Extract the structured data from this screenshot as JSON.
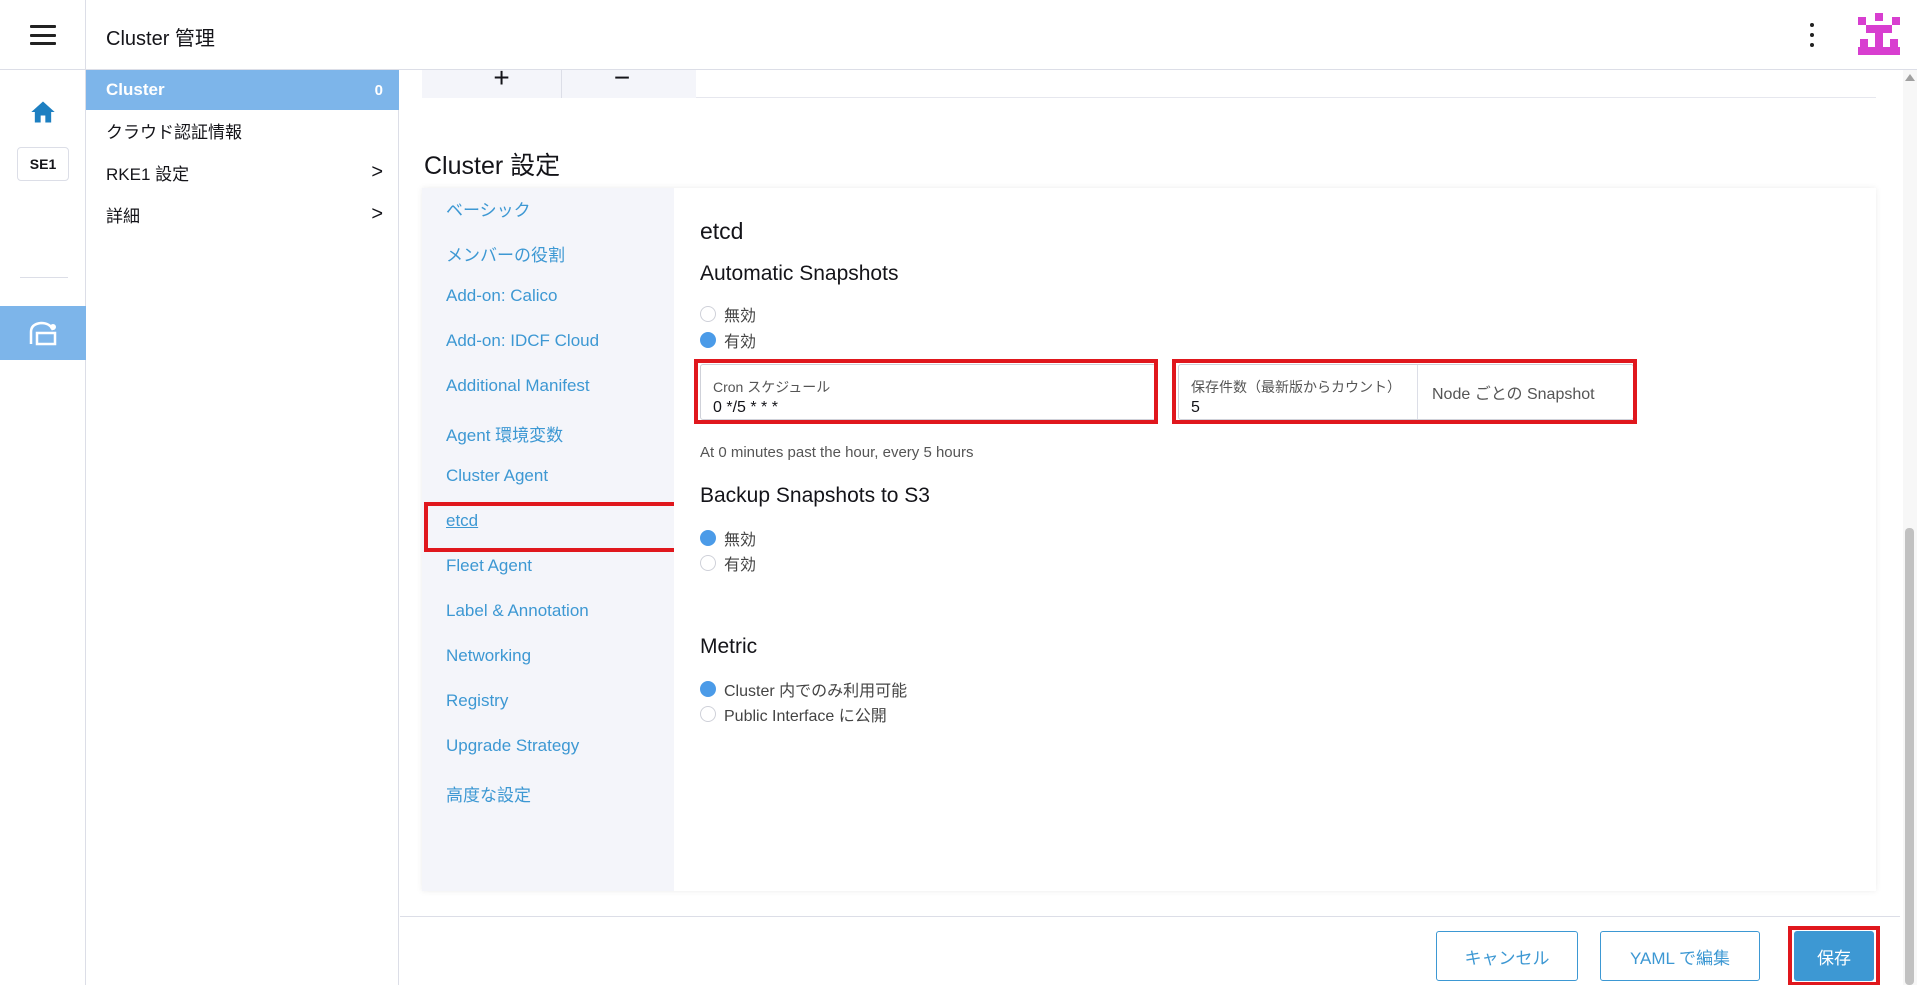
{
  "header": {
    "title": "Cluster 管理",
    "menu_icon": "hamburger-icon",
    "more_icon": "kebab-icon",
    "avatar_color": "#d83ed0"
  },
  "rail": {
    "home_icon": "home-icon",
    "cluster_badge": "SE1",
    "active_icon": "cluster-icon"
  },
  "subnav": {
    "items": [
      {
        "label": "Cluster",
        "count": "0",
        "active": true
      },
      {
        "label": "クラウド認証情報"
      },
      {
        "label": "RKE1 設定",
        "chevron": ">"
      },
      {
        "label": "詳細",
        "chevron": ">"
      }
    ]
  },
  "main": {
    "top_card": {
      "plus": "+",
      "minus": "−"
    },
    "section_title": "Cluster 設定",
    "settings_nav": [
      "ベーシック",
      "メンバーの役割",
      "Add-on: Calico",
      "Add-on: IDCF Cloud",
      "Additional Manifest",
      "Agent 環境変数",
      "Cluster Agent",
      "etcd",
      "Fleet Agent",
      "Label & Annotation",
      "Networking",
      "Registry",
      "Upgrade Strategy",
      "高度な設定"
    ],
    "settings_nav_current": "etcd",
    "etcd": {
      "title": "etcd",
      "automatic_snapshots": {
        "heading": "Automatic Snapshots",
        "options": [
          "無効",
          "有効"
        ],
        "selected": "有効"
      },
      "cron": {
        "label": "Cron スケジュール",
        "value": "0 */5 * * *",
        "hint": "At 0 minutes past the hour, every 5 hours"
      },
      "retention": {
        "label": "保存件数（最新版からカウント）",
        "value": "5",
        "suffix": "Node ごとの Snapshot"
      },
      "backup_s3": {
        "heading": "Backup Snapshots to S3",
        "options": [
          "無効",
          "有効"
        ],
        "selected": "無効"
      },
      "metric": {
        "heading": "Metric",
        "options": [
          "Cluster 内でのみ利用可能",
          "Public Interface に公開"
        ],
        "selected": "Cluster 内でのみ利用可能"
      }
    }
  },
  "footer": {
    "cancel": "キャンセル",
    "yaml": "YAML で編集",
    "save": "保存"
  },
  "colors": {
    "accent": "#3d98d3",
    "active_nav": "#7db5ea",
    "highlight": "#e0171d"
  }
}
